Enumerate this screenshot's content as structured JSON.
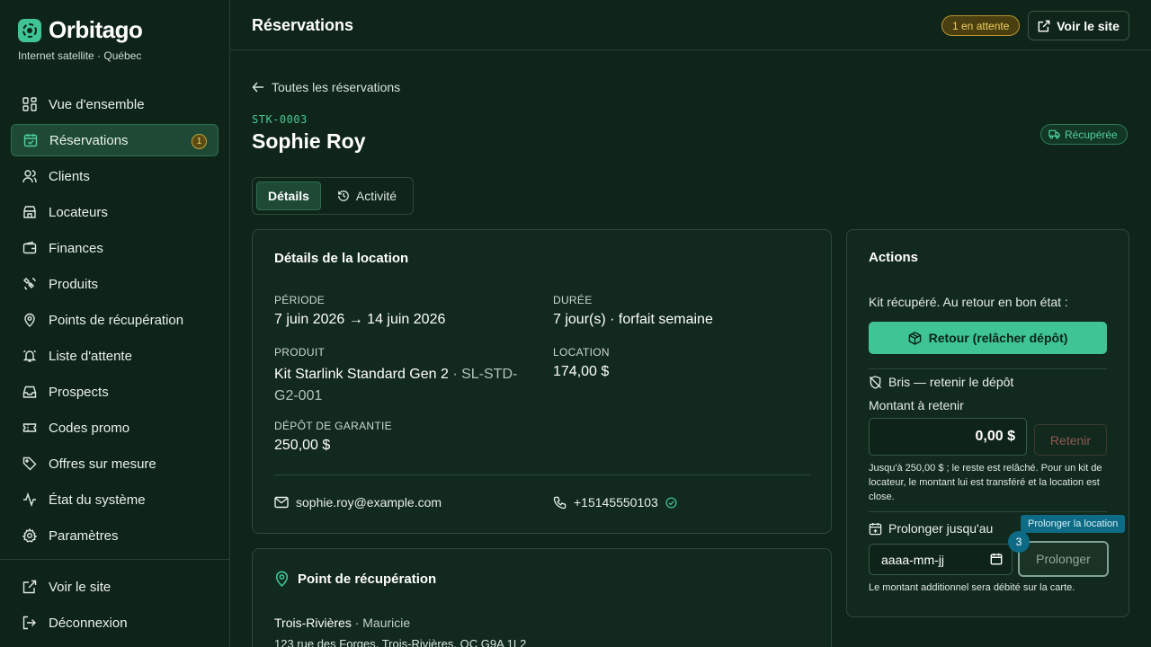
{
  "brand": {
    "name": "Orbitago",
    "subtitle": "Internet satellite · Québec"
  },
  "sidebar": {
    "items": [
      {
        "label": "Vue d'ensemble",
        "icon": "dashboard-icon"
      },
      {
        "label": "Réservations",
        "icon": "calendar-check-icon",
        "active": true,
        "badge": "1"
      },
      {
        "label": "Clients",
        "icon": "users-icon"
      },
      {
        "label": "Locateurs",
        "icon": "store-icon"
      },
      {
        "label": "Finances",
        "icon": "wallet-icon"
      },
      {
        "label": "Produits",
        "icon": "satellite-icon"
      },
      {
        "label": "Points de récupération",
        "icon": "map-pin-icon"
      },
      {
        "label": "Liste d'attente",
        "icon": "bell-icon"
      },
      {
        "label": "Prospects",
        "icon": "inbox-icon"
      },
      {
        "label": "Codes promo",
        "icon": "ticket-icon"
      },
      {
        "label": "Offres sur mesure",
        "icon": "tag-icon"
      },
      {
        "label": "État du système",
        "icon": "activity-icon"
      },
      {
        "label": "Paramètres",
        "icon": "gear-icon"
      }
    ],
    "bottom": [
      {
        "label": "Voir le site",
        "icon": "external-link-icon"
      },
      {
        "label": "Déconnexion",
        "icon": "logout-icon"
      }
    ]
  },
  "header": {
    "title": "Réservations",
    "pending": "1 en attente",
    "site_button": "Voir le site"
  },
  "page": {
    "back": "Toutes les réservations",
    "ref": "STK-0003",
    "customer": "Sophie Roy",
    "status": "Récupérée",
    "tabs": [
      "Détails",
      "Activité"
    ]
  },
  "details": {
    "title": "Détails de la location",
    "period_label": "PÉRIODE",
    "period": "7 juin 2026 → 14 juin 2026",
    "duration_label": "DURÉE",
    "duration": "7 jour(s) · forfait semaine",
    "product_label": "PRODUIT",
    "product_name": "Kit Starlink Standard Gen 2",
    "product_sku": " · SL-STD-G2-001",
    "rental_label": "LOCATION",
    "rental": "174,00 $",
    "deposit_label": "DÉPÔT DE GARANTIE",
    "deposit": "250,00 $",
    "email": "sophie.roy@example.com",
    "phone": "+15145550103"
  },
  "pickup": {
    "title": "Point de récupération",
    "city": "Trois-Rivières",
    "region": " · Mauricie",
    "address": "123 rue des Forges, Trois-Rivières, QC G9A 1L2"
  },
  "actions": {
    "title": "Actions",
    "intro": "Kit récupéré. Au retour en bon état :",
    "return_button": "Retour (relâcher dépôt)",
    "damage_title": "Bris — retenir le dépôt",
    "amount_label": "Montant à retenir",
    "amount_value": "0,00 $",
    "retain_button": "Retenir",
    "retain_note": "Jusqu'à 250,00 $ ; le reste est relâché. Pour un kit de locateur, le montant lui est transféré et la location est close.",
    "extend_title": "Prolonger jusqu'au",
    "date_placeholder": "aaaa-mm-jj",
    "extend_button": "Prolonger",
    "extend_note": "Le montant additionnel sera débité sur la carte.",
    "tooltip": "Prolonger la location",
    "step": "3"
  },
  "colors": {
    "accent": "#3fc493",
    "background": "#0f2519",
    "pending": "#f0cf5b",
    "tooltip": "#0d6b86"
  }
}
